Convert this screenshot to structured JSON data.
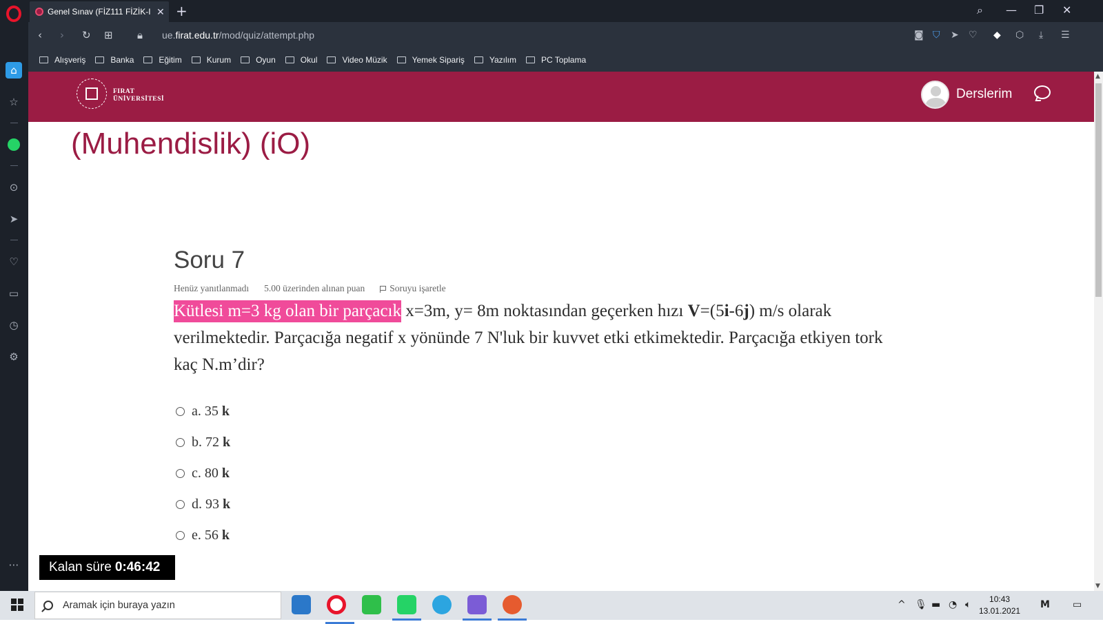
{
  "browser": {
    "tab_title": "Genel Sınav (FİZ111 FİZİK-I",
    "new_tab": "+",
    "url_prefix": "ue.",
    "url_domain": "firat.edu.tr",
    "url_path": "/mod/quiz/attempt.php",
    "bookmarks": [
      "Alışveriş",
      "Banka",
      "Eğitim",
      "Kurum",
      "Oyun",
      "Okul",
      "Video Müzik",
      "Yemek Sipariş",
      "Yazılım",
      "PC Toplama"
    ]
  },
  "site": {
    "logo_line1": "FIRAT",
    "logo_line2": "ÜNİVERSİTESİ",
    "nav_link": "Derslerim",
    "brand_color": "#9b1c44"
  },
  "course": {
    "title": "(Muhendislik) (iO)"
  },
  "question": {
    "title": "Soru 7",
    "status": "Henüz yanıtlanmadı",
    "points": "5.00 üzerinden alınan puan",
    "flag_label": "Soruyu işaretle",
    "text_highlight": "Kütlesi m=3 kg olan bir parçacık",
    "text_part1": " x=3m, y= 8m noktasından geçerken hızı ",
    "text_bold_v": "V",
    "text_part2": "=(5",
    "text_bold_i": "i",
    "text_part3": "-6",
    "text_bold_j": "j",
    "text_part4": ")  m/s olarak verilmektedir. Parçacığa negatif x yönünde 7 N'luk bir kuvvet etki etkimektedir. Parçacığa etkiyen tork kaç N.m’dir?",
    "answers": [
      {
        "prefix": "a. 35 ",
        "unit": "k"
      },
      {
        "prefix": "b. 72 ",
        "unit": "k"
      },
      {
        "prefix": "c. 80 ",
        "unit": "k"
      },
      {
        "prefix": "d. 93 ",
        "unit": "k"
      },
      {
        "prefix": "e. 56 ",
        "unit": "k"
      }
    ]
  },
  "timer": {
    "label": "Kalan süre",
    "value": "0:46:42"
  },
  "taskbar": {
    "search_placeholder": "Aramak için buraya yazın",
    "time": "10:43",
    "date": "13.01.2021"
  }
}
